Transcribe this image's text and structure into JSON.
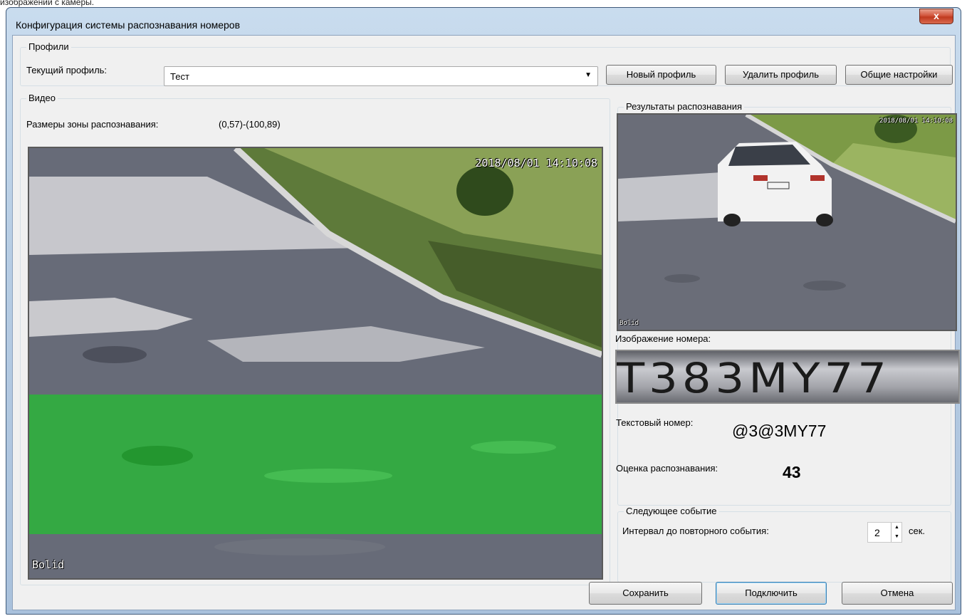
{
  "window": {
    "title": "Конфигурация системы распознавания номеров",
    "close_glyph": "x"
  },
  "profiles": {
    "legend": "Профили",
    "current_label": "Текущий профиль:",
    "current_value": "Тест",
    "new_label": "Новый профиль",
    "delete_label": "Удалить профиль",
    "settings_label": "Общие настройки"
  },
  "video": {
    "legend": "Видео",
    "zone_label": "Размеры зоны распознавания:",
    "zone_value": "(0,57)-(100,89)",
    "timestamp": "2018/08/01 14:10:08",
    "watermark": "Bolid",
    "zone_color": "#2bb43a"
  },
  "results": {
    "legend": "Результаты распознавания",
    "plate_image_label": "Изображение номера:",
    "plate_image_text": "T383MY77",
    "text_number_label": "Текстовый номер:",
    "text_number_value": "@3@3MY77",
    "score_label": "Оценка распознавания:",
    "score_value": "43"
  },
  "next_event": {
    "legend": "Следующее событие",
    "interval_label": "Интервал до повторного события:",
    "interval_value": "2",
    "unit": "сек."
  },
  "footer": {
    "save_label": "Сохранить",
    "connect_label": "Подключить",
    "cancel_label": "Отмена"
  },
  "page_header_clip": "изображений с камеры."
}
